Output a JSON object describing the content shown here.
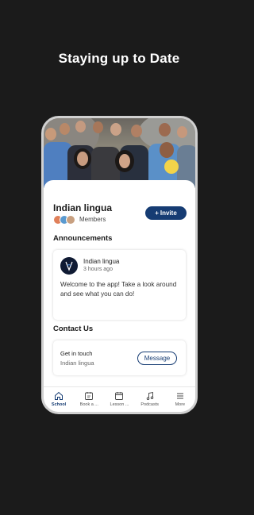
{
  "promo": {
    "title": "Staying up to Date"
  },
  "school": {
    "name": "Indian lingua",
    "members_label": "Members",
    "invite_label": "Invite",
    "invite_plus": "+"
  },
  "announcements": {
    "section_title": "Announcements",
    "author": "Indian lingua",
    "time": "3 hours ago",
    "body": "Welcome to the app! Take a look around and see what you can do!"
  },
  "contact": {
    "section_title": "Contact Us",
    "title": "Get in touch",
    "subtitle": "Indian lingua",
    "message_label": "Message"
  },
  "tabs": [
    {
      "label": "School",
      "icon": "home-icon",
      "active": true
    },
    {
      "label": "Book a ...",
      "icon": "calendar-booking-icon",
      "active": false
    },
    {
      "label": "Lesson ...",
      "icon": "calendar-icon",
      "active": false
    },
    {
      "label": "Podcasts",
      "icon": "music-note-icon",
      "active": false
    },
    {
      "label": "More",
      "icon": "menu-icon",
      "active": false
    }
  ],
  "colors": {
    "accent": "#163c73",
    "background": "#1b1b1b"
  }
}
